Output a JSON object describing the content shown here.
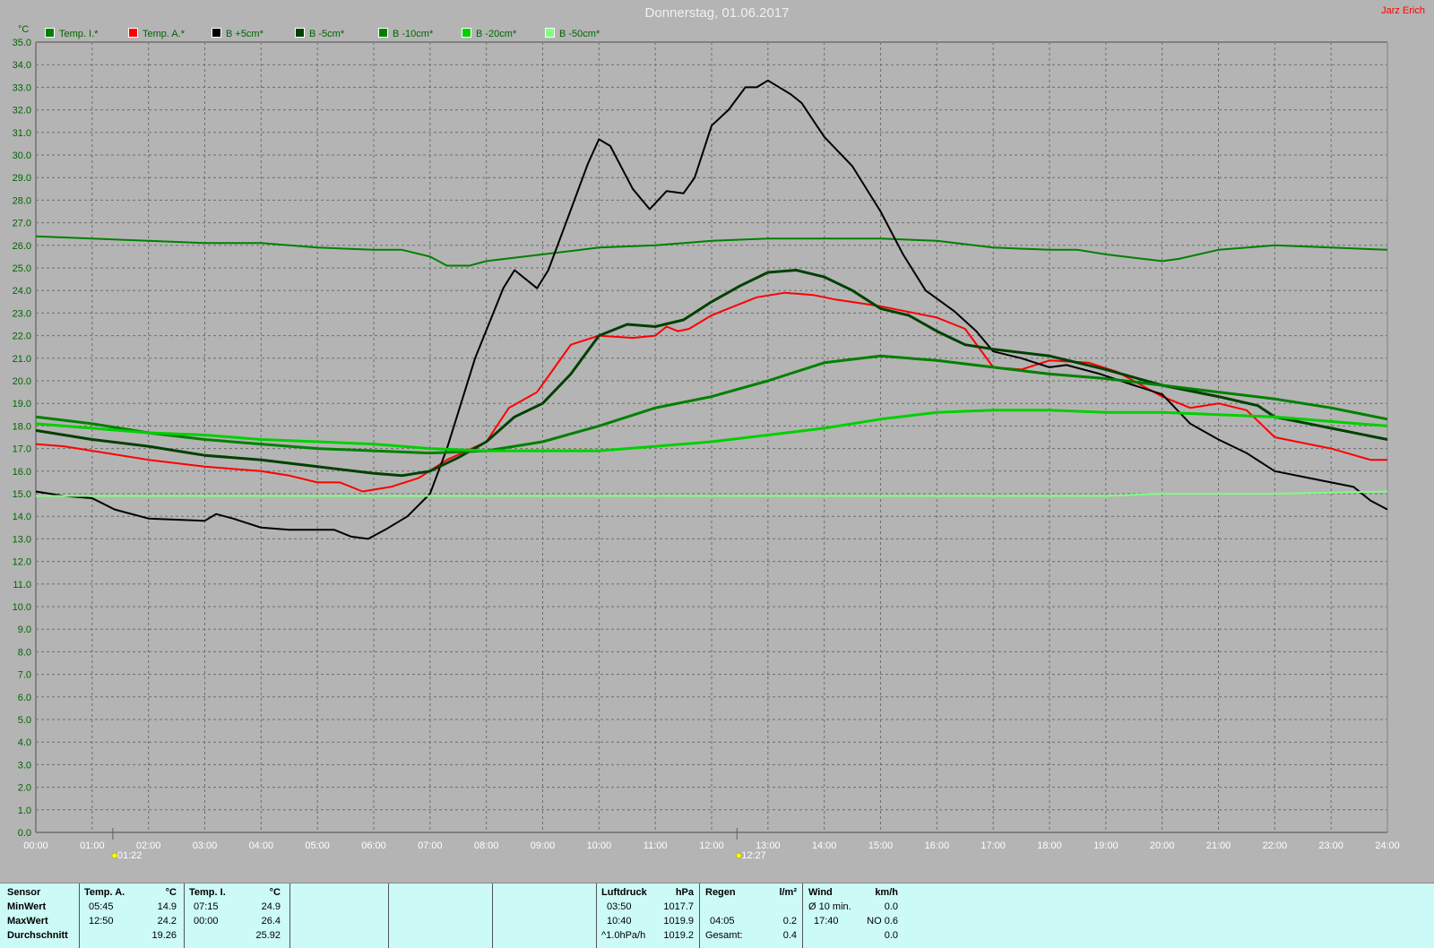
{
  "header": {
    "title": "Donnerstag, 01.06.2017",
    "author": "Jarz Erich"
  },
  "chart_data": {
    "type": "line",
    "title": "Donnerstag, 01.06.2017",
    "ylabel": "°C",
    "xlabel": "",
    "ylim": [
      0,
      35
    ],
    "ystep": 1,
    "xlim": [
      0,
      24
    ],
    "xticks": [
      "00:00",
      "01:00",
      "02:00",
      "03:00",
      "04:00",
      "05:00",
      "06:00",
      "07:00",
      "08:00",
      "09:00",
      "10:00",
      "11:00",
      "12:00",
      "13:00",
      "14:00",
      "15:00",
      "16:00",
      "17:00",
      "18:00",
      "19:00",
      "20:00",
      "21:00",
      "22:00",
      "23:00",
      "24:00"
    ],
    "grid": true,
    "legend_position": "top-left",
    "markers": [
      {
        "label": "01:22",
        "hour": 1.367,
        "icon": "sunrise-icon"
      },
      {
        "label": "12:27",
        "hour": 12.45,
        "icon": "sun-icon"
      }
    ],
    "series": [
      {
        "name": "Temp. I.*",
        "color": "#008000",
        "width": 2,
        "points": [
          [
            0,
            26.4
          ],
          [
            1,
            26.3
          ],
          [
            2,
            26.2
          ],
          [
            3,
            26.1
          ],
          [
            4,
            26.1
          ],
          [
            5,
            25.9
          ],
          [
            6,
            25.8
          ],
          [
            6.5,
            25.8
          ],
          [
            7,
            25.5
          ],
          [
            7.3,
            25.1
          ],
          [
            7.7,
            25.1
          ],
          [
            8,
            25.3
          ],
          [
            9,
            25.6
          ],
          [
            10,
            25.9
          ],
          [
            11,
            26.0
          ],
          [
            12,
            26.2
          ],
          [
            13,
            26.3
          ],
          [
            14,
            26.3
          ],
          [
            15,
            26.3
          ],
          [
            16,
            26.2
          ],
          [
            17,
            25.9
          ],
          [
            18,
            25.8
          ],
          [
            18.5,
            25.8
          ],
          [
            19,
            25.6
          ],
          [
            20,
            25.3
          ],
          [
            20.3,
            25.4
          ],
          [
            21,
            25.8
          ],
          [
            22,
            26.0
          ],
          [
            23,
            25.9
          ],
          [
            24,
            25.8
          ]
        ]
      },
      {
        "name": "Temp. A.*",
        "color": "#ff0000",
        "width": 2,
        "points": [
          [
            0,
            17.2
          ],
          [
            0.5,
            17.1
          ],
          [
            1,
            16.9
          ],
          [
            2,
            16.5
          ],
          [
            3,
            16.2
          ],
          [
            4,
            16.0
          ],
          [
            4.5,
            15.8
          ],
          [
            5,
            15.5
          ],
          [
            5.4,
            15.5
          ],
          [
            5.8,
            15.1
          ],
          [
            6.3,
            15.3
          ],
          [
            6.8,
            15.7
          ],
          [
            7.3,
            16.5
          ],
          [
            8,
            17.3
          ],
          [
            8.4,
            18.8
          ],
          [
            8.9,
            19.5
          ],
          [
            9.1,
            20.2
          ],
          [
            9.5,
            21.6
          ],
          [
            10,
            22.0
          ],
          [
            10.6,
            21.9
          ],
          [
            11,
            22.0
          ],
          [
            11.2,
            22.4
          ],
          [
            11.4,
            22.2
          ],
          [
            11.6,
            22.3
          ],
          [
            12,
            22.9
          ],
          [
            12.4,
            23.3
          ],
          [
            12.8,
            23.7
          ],
          [
            13.3,
            23.9
          ],
          [
            13.8,
            23.8
          ],
          [
            14.2,
            23.6
          ],
          [
            15,
            23.3
          ],
          [
            16,
            22.8
          ],
          [
            16.5,
            22.3
          ],
          [
            17,
            20.6
          ],
          [
            17.5,
            20.5
          ],
          [
            18,
            20.9
          ],
          [
            18.7,
            20.8
          ],
          [
            19.2,
            20.4
          ],
          [
            20,
            19.3
          ],
          [
            20.5,
            18.8
          ],
          [
            21,
            19.0
          ],
          [
            21.5,
            18.7
          ],
          [
            22,
            17.5
          ],
          [
            23,
            17.0
          ],
          [
            23.7,
            16.5
          ],
          [
            24,
            16.5
          ]
        ]
      },
      {
        "name": "B +5cm*",
        "color": "#000000",
        "width": 2,
        "points": [
          [
            0,
            15.1
          ],
          [
            0.5,
            14.9
          ],
          [
            1,
            14.8
          ],
          [
            1.4,
            14.3
          ],
          [
            2,
            13.9
          ],
          [
            3,
            13.8
          ],
          [
            3.2,
            14.1
          ],
          [
            3.5,
            13.9
          ],
          [
            4,
            13.5
          ],
          [
            4.5,
            13.4
          ],
          [
            5.3,
            13.4
          ],
          [
            5.6,
            13.1
          ],
          [
            5.9,
            13.0
          ],
          [
            6.2,
            13.4
          ],
          [
            6.6,
            14.0
          ],
          [
            7,
            15.0
          ],
          [
            7.3,
            17.0
          ],
          [
            7.8,
            21.0
          ],
          [
            8.3,
            24.1
          ],
          [
            8.5,
            24.9
          ],
          [
            8.9,
            24.1
          ],
          [
            9.1,
            24.9
          ],
          [
            9.4,
            26.9
          ],
          [
            9.8,
            29.6
          ],
          [
            10,
            30.7
          ],
          [
            10.2,
            30.4
          ],
          [
            10.6,
            28.5
          ],
          [
            10.9,
            27.6
          ],
          [
            11.2,
            28.4
          ],
          [
            11.5,
            28.3
          ],
          [
            11.7,
            29.0
          ],
          [
            12,
            31.3
          ],
          [
            12.3,
            32.0
          ],
          [
            12.6,
            33.0
          ],
          [
            12.8,
            33.0
          ],
          [
            13,
            33.3
          ],
          [
            13.4,
            32.7
          ],
          [
            13.6,
            32.3
          ],
          [
            14,
            30.8
          ],
          [
            14.5,
            29.5
          ],
          [
            15,
            27.5
          ],
          [
            15.4,
            25.6
          ],
          [
            15.8,
            24.0
          ],
          [
            16.3,
            23.1
          ],
          [
            16.7,
            22.2
          ],
          [
            17,
            21.3
          ],
          [
            17.5,
            21.0
          ],
          [
            18,
            20.6
          ],
          [
            18.3,
            20.7
          ],
          [
            18.9,
            20.3
          ],
          [
            19.5,
            19.8
          ],
          [
            20,
            19.4
          ],
          [
            20.5,
            18.1
          ],
          [
            21,
            17.4
          ],
          [
            21.5,
            16.8
          ],
          [
            22,
            16.0
          ],
          [
            22.8,
            15.6
          ],
          [
            23.4,
            15.3
          ],
          [
            23.7,
            14.7
          ],
          [
            24,
            14.3
          ]
        ]
      },
      {
        "name": "B -5cm*",
        "color": "#004000",
        "width": 3,
        "points": [
          [
            0,
            17.8
          ],
          [
            1,
            17.4
          ],
          [
            2,
            17.1
          ],
          [
            3,
            16.7
          ],
          [
            4,
            16.5
          ],
          [
            5,
            16.2
          ],
          [
            6,
            15.9
          ],
          [
            6.5,
            15.8
          ],
          [
            7,
            16.0
          ],
          [
            7.5,
            16.6
          ],
          [
            8,
            17.3
          ],
          [
            8.5,
            18.4
          ],
          [
            9,
            19.0
          ],
          [
            9.5,
            20.3
          ],
          [
            10,
            22.0
          ],
          [
            10.5,
            22.5
          ],
          [
            11,
            22.4
          ],
          [
            11.5,
            22.7
          ],
          [
            12,
            23.5
          ],
          [
            12.5,
            24.2
          ],
          [
            13,
            24.8
          ],
          [
            13.5,
            24.9
          ],
          [
            14,
            24.6
          ],
          [
            14.5,
            24.0
          ],
          [
            15,
            23.2
          ],
          [
            15.5,
            22.9
          ],
          [
            16,
            22.2
          ],
          [
            16.5,
            21.6
          ],
          [
            17,
            21.4
          ],
          [
            18,
            21.1
          ],
          [
            18.5,
            20.8
          ],
          [
            19,
            20.5
          ],
          [
            20,
            19.8
          ],
          [
            21,
            19.3
          ],
          [
            21.7,
            18.9
          ],
          [
            22,
            18.4
          ],
          [
            23,
            17.9
          ],
          [
            24,
            17.4
          ]
        ]
      },
      {
        "name": "B -10cm*",
        "color": "#008000",
        "width": 3,
        "points": [
          [
            0,
            18.4
          ],
          [
            1,
            18.1
          ],
          [
            2,
            17.7
          ],
          [
            3,
            17.4
          ],
          [
            4,
            17.2
          ],
          [
            5,
            17.0
          ],
          [
            6,
            16.9
          ],
          [
            7,
            16.8
          ],
          [
            8,
            16.9
          ],
          [
            9,
            17.3
          ],
          [
            10,
            18.0
          ],
          [
            11,
            18.8
          ],
          [
            12,
            19.3
          ],
          [
            13,
            20.0
          ],
          [
            14,
            20.8
          ],
          [
            15,
            21.1
          ],
          [
            16,
            20.9
          ],
          [
            17,
            20.6
          ],
          [
            18,
            20.3
          ],
          [
            19,
            20.1
          ],
          [
            20,
            19.8
          ],
          [
            21,
            19.5
          ],
          [
            22,
            19.2
          ],
          [
            23,
            18.8
          ],
          [
            24,
            18.3
          ]
        ]
      },
      {
        "name": "B -20cm*",
        "color": "#00d000",
        "width": 3,
        "points": [
          [
            0,
            18.1
          ],
          [
            1,
            17.9
          ],
          [
            2,
            17.7
          ],
          [
            3,
            17.6
          ],
          [
            4,
            17.4
          ],
          [
            5,
            17.3
          ],
          [
            6,
            17.2
          ],
          [
            7,
            17.0
          ],
          [
            8,
            16.9
          ],
          [
            9,
            16.9
          ],
          [
            10,
            16.9
          ],
          [
            11,
            17.1
          ],
          [
            12,
            17.3
          ],
          [
            13,
            17.6
          ],
          [
            14,
            17.9
          ],
          [
            15,
            18.3
          ],
          [
            16,
            18.6
          ],
          [
            17,
            18.7
          ],
          [
            18,
            18.7
          ],
          [
            19,
            18.6
          ],
          [
            20,
            18.6
          ],
          [
            21,
            18.5
          ],
          [
            22,
            18.4
          ],
          [
            23,
            18.2
          ],
          [
            24,
            18.0
          ]
        ]
      },
      {
        "name": "B -50cm*",
        "color": "#80ff80",
        "width": 2,
        "points": [
          [
            0,
            14.9
          ],
          [
            10,
            14.9
          ],
          [
            19,
            14.9
          ],
          [
            20,
            15.0
          ],
          [
            22,
            15.0
          ],
          [
            24,
            15.1
          ]
        ]
      }
    ]
  },
  "stats": {
    "sensor": {
      "header": "Sensor",
      "rows": [
        "MinWert",
        "MaxWert",
        "Durchschnitt"
      ]
    },
    "temp_a": {
      "header": "Temp. A.",
      "unit": "°C",
      "min_time": "05:45",
      "min": "14.9",
      "max_time": "12:50",
      "max": "24.2",
      "avg": "19.26"
    },
    "temp_i": {
      "header": "Temp. I.",
      "unit": "°C",
      "min_time": "07:15",
      "min": "24.9",
      "max_time": "00:00",
      "max": "26.4",
      "avg": "25.92"
    },
    "pressure": {
      "header": "Luftdruck",
      "unit": "hPa",
      "r1_label": "03:50",
      "r1": "1017.7",
      "r2_label": "10:40",
      "r2": "1019.9",
      "r3_label": "^1.0hPa/h",
      "r3": "1019.2"
    },
    "rain": {
      "header": "Regen",
      "unit": "l/m²",
      "r2_label": "04:05",
      "r2": "0.2",
      "r3_label": "Gesamt:",
      "r3": "0.4"
    },
    "wind": {
      "header": "Wind",
      "unit": "km/h",
      "r1_label": "Ø 10 min.",
      "r1": "0.0",
      "r2_label": "17:40",
      "r2": "NO 0.6",
      "r3": "0.0"
    }
  }
}
